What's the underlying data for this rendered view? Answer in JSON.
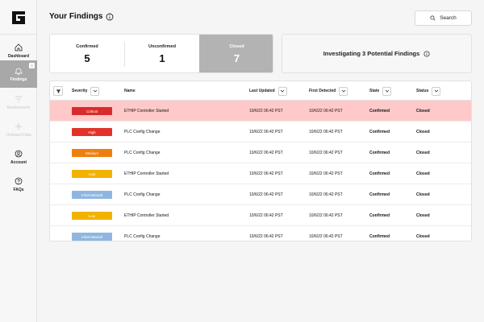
{
  "sidebar": {
    "logo": "G",
    "items": [
      {
        "label": "Dashboard",
        "icon": "home-icon"
      },
      {
        "label": "Findings",
        "icon": "bell-icon",
        "badge": "0"
      },
      {
        "label": "Environment",
        "icon": "filter-icon"
      },
      {
        "label": "Onboard Data",
        "icon": "plus-icon"
      },
      {
        "label": "Account",
        "icon": "user-icon"
      },
      {
        "label": "FAQs",
        "icon": "help-icon"
      }
    ]
  },
  "header": {
    "title": "Your Findings",
    "search_label": "Search"
  },
  "stats": {
    "confirmed_label": "Confirmed",
    "confirmed_value": "5",
    "unconfirmed_label": "Unconfirmed",
    "unconfirmed_value": "1",
    "closed_label": "Closed",
    "closed_value": "7"
  },
  "investigating": {
    "text": "Investigating 3 Potential Findings"
  },
  "table": {
    "columns": {
      "severity": "Severity",
      "name": "Name",
      "last_updated": "Last Updated",
      "first_detected": "First Detected",
      "state": "State",
      "status": "Status"
    },
    "rows": [
      {
        "severity": "Critical",
        "name": "ETHIP Controller Started",
        "last_updated": "10/6/22 06:42 PST",
        "first_detected": "10/6/22 06:42 PST",
        "state": "Confirmed",
        "status": "Closed"
      },
      {
        "severity": "High",
        "name": "PLC Config Change",
        "last_updated": "10/6/22 06:42 PST",
        "first_detected": "10/6/22 06:42 PST",
        "state": "Confirmed",
        "status": "Closed"
      },
      {
        "severity": "Medium",
        "name": "PLC Config Change",
        "last_updated": "10/6/22 06:42 PST",
        "first_detected": "10/6/22 06:42 PST",
        "state": "Confirmed",
        "status": "Closed"
      },
      {
        "severity": "Low",
        "name": "ETHIP Controller Started",
        "last_updated": "10/6/22 06:42 PST",
        "first_detected": "10/6/22 06:42 PST",
        "state": "Confirmed",
        "status": "Closed"
      },
      {
        "severity": "Informational",
        "name": "PLC Config Change",
        "last_updated": "10/6/22 06:42 PST",
        "first_detected": "10/6/22 06:42 PST",
        "state": "Confirmed",
        "status": "Closed"
      },
      {
        "severity": "Low",
        "name": "ETHIP Controller Started",
        "last_updated": "10/6/22 06:42 PST",
        "first_detected": "10/6/22 06:42 PST",
        "state": "Confirmed",
        "status": "Closed"
      },
      {
        "severity": "Informational",
        "name": "PLC Config Change",
        "last_updated": "10/6/22 06:42 PST",
        "first_detected": "10/6/22 06:42 PST",
        "state": "Confirmed",
        "status": "Closed"
      }
    ]
  },
  "colors": {
    "critical": "#d92b2b",
    "high": "#e0342a",
    "medium": "#ee7f0f",
    "low": "#f2b200",
    "informational": "#8fb6e0",
    "highlight_row": "#ffc9c9",
    "selected_stat": "#b3b3b3"
  }
}
